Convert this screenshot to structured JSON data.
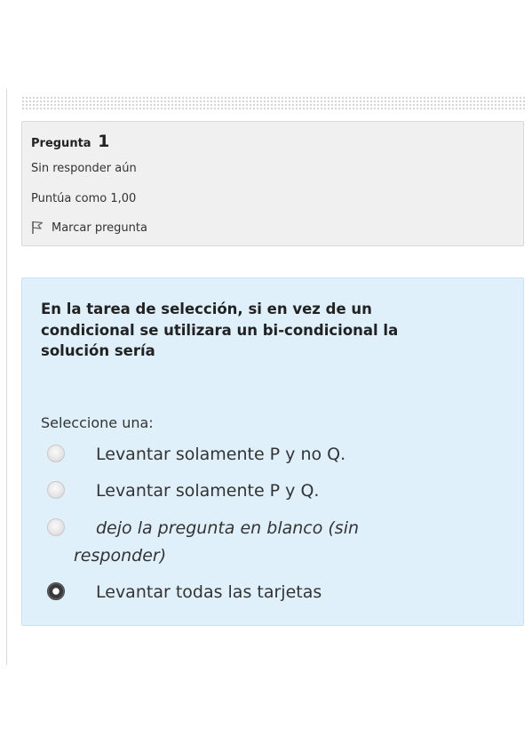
{
  "question_info": {
    "label": "Pregunta",
    "number": "1",
    "state": "Sin responder aún",
    "grade": "Puntúa como 1,00",
    "flag_label": "Marcar pregunta"
  },
  "question": {
    "text": "En la tarea de selección, si en vez de un condicional se utilizara un bi-condicional la solución sería",
    "prompt": "Seleccione una:",
    "options": [
      {
        "label": "Levantar solamente P y no Q.",
        "selected": false
      },
      {
        "label": "Levantar solamente P y Q.",
        "selected": false
      },
      {
        "label_line1": "dejo la pregunta en blanco (sin",
        "label_line2": "responder)",
        "selected": false
      },
      {
        "label": "Levantar todas las tarjetas",
        "selected": true
      }
    ]
  },
  "colors": {
    "info_background": "#f0f0f0",
    "content_background": "#dff0fa"
  }
}
